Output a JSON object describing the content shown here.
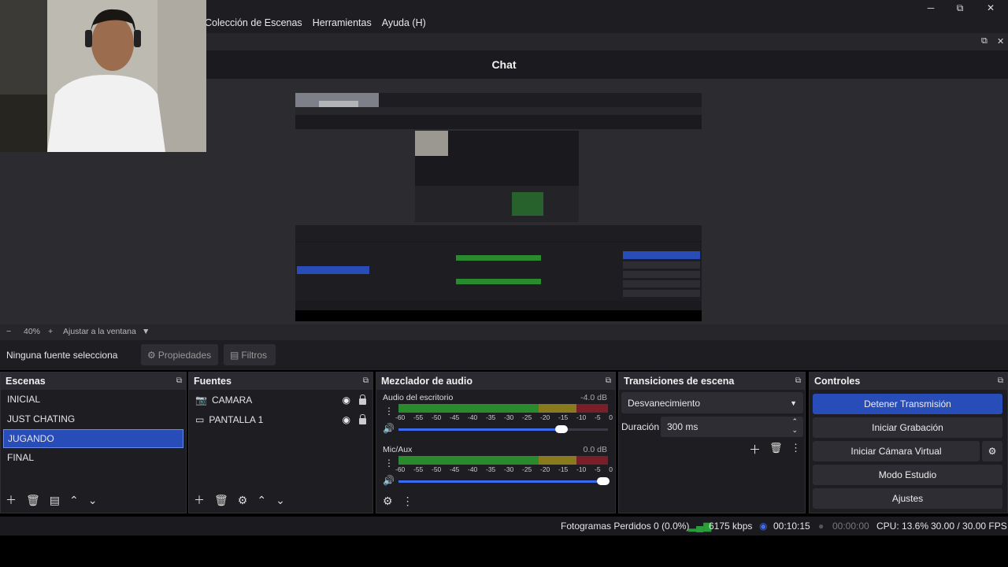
{
  "menu": [
    "Colección de Escenas",
    "Herramientas",
    "Ayuda (H)"
  ],
  "window_controls": {
    "minimize": "─",
    "restore": "⧉",
    "close": "✕"
  },
  "chat_dock": {
    "title": "Chat"
  },
  "zoom": {
    "minus": "−",
    "value": "40%",
    "plus": "+",
    "fit": "Ajustar a la ventana"
  },
  "source_toolbar": {
    "label": "Ninguna fuente selecciona",
    "properties": "Propiedades",
    "filters": "Filtros"
  },
  "scenes": {
    "title": "Escenas",
    "items": [
      "INICIAL",
      "JUST CHATING",
      "JUGANDO",
      "FINAL"
    ],
    "selected_index": 2
  },
  "sources": {
    "title": "Fuentes",
    "items": [
      {
        "label": "CAMARA",
        "icon": "camera-icon"
      },
      {
        "label": "PANTALLA 1",
        "icon": "monitor-icon"
      }
    ]
  },
  "mixer": {
    "title": "Mezclador de audio",
    "channels": [
      {
        "name": "Audio del escritorio",
        "db": "-4.0 dB",
        "volume": 0.8
      },
      {
        "name": "Mic/Aux",
        "db": "0.0 dB",
        "volume": 1.0
      }
    ],
    "ticks": [
      "-60",
      "-55",
      "-50",
      "-45",
      "-40",
      "-35",
      "-30",
      "-25",
      "-20",
      "-15",
      "-10",
      "-5",
      "0"
    ]
  },
  "transitions": {
    "title": "Transiciones de escena",
    "selected": "Desvanecimiento",
    "duration_label": "Duración",
    "duration_value": "300 ms"
  },
  "controls": {
    "title": "Controles",
    "buttons": [
      "Detener Transmisión",
      "Iniciar Grabación",
      "Iniciar Cámara Virtual",
      "Modo Estudio",
      "Ajustes"
    ]
  },
  "status": {
    "dropped": "Fotogramas Perdidos 0 (0.0%)",
    "bitrate": "6175 kbps",
    "stream_time": "00:10:15",
    "rec_time": "00:00:00",
    "cpu": "CPU: 13.6%",
    "fps": "30.00 / 30.00 FPS"
  },
  "colors": {
    "accent": "#284cb8",
    "panel": "#1e1e22",
    "live": "#2a9c3a"
  }
}
